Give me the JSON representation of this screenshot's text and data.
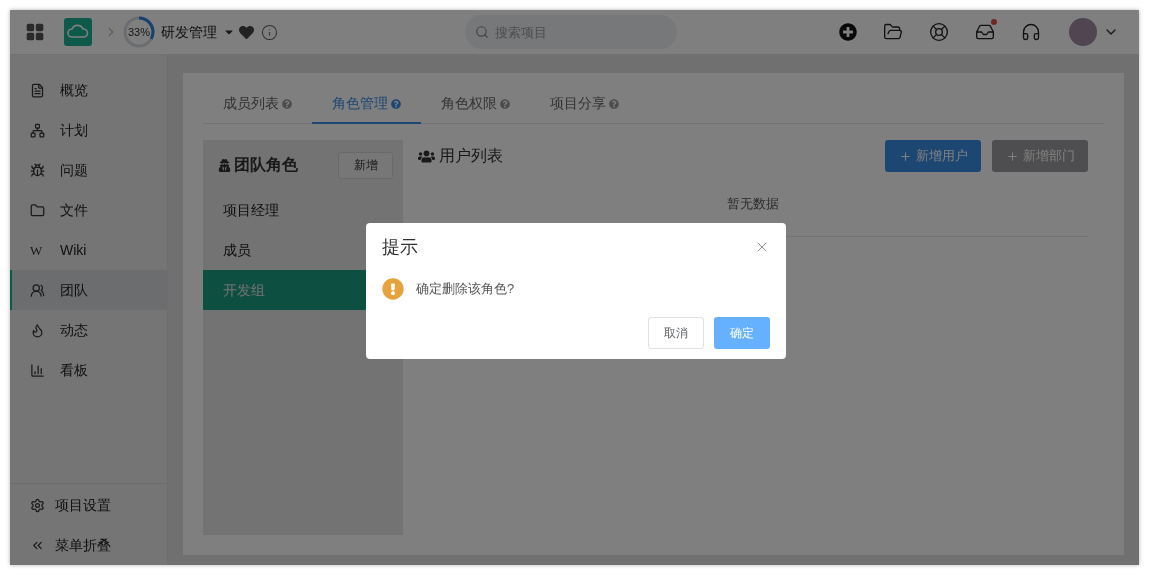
{
  "header": {
    "progress": {
      "label": "33%",
      "level": 0.33
    },
    "project_title": "研发管理",
    "search": {
      "placeholder": "搜索项目"
    },
    "toolbar": [
      {
        "kind": "add"
      },
      {
        "kind": "folder"
      },
      {
        "kind": "help"
      },
      {
        "kind": "inbox",
        "unread": true
      },
      {
        "kind": "support"
      }
    ]
  },
  "sidebar": {
    "items": [
      {
        "kind": "overview",
        "label": "概览",
        "selected": false
      },
      {
        "kind": "plan",
        "label": "计划",
        "selected": false
      },
      {
        "kind": "issue",
        "label": "问题",
        "selected": false
      },
      {
        "kind": "file",
        "label": "文件",
        "selected": false
      },
      {
        "kind": "wiki",
        "glyph": "W",
        "label": "Wiki",
        "selected": false
      },
      {
        "kind": "team",
        "label": "团队",
        "selected": true
      },
      {
        "kind": "activity",
        "label": "动态",
        "selected": false
      },
      {
        "kind": "board",
        "label": "看板",
        "selected": false
      }
    ],
    "footer": [
      {
        "kind": "settings",
        "label": "项目设置"
      },
      {
        "kind": "collapse",
        "label": "菜单折叠"
      }
    ]
  },
  "tabs": [
    {
      "label": "成员列表",
      "selected": false
    },
    {
      "label": "角色管理",
      "selected": true
    },
    {
      "label": "角色权限",
      "selected": false
    },
    {
      "label": "项目分享",
      "selected": false
    }
  ],
  "roles": {
    "title": "团队角色",
    "add_button": "新增",
    "items": [
      {
        "label": "项目经理",
        "selected": false
      },
      {
        "label": "成员",
        "selected": false
      },
      {
        "label": "开发组",
        "selected": true
      }
    ]
  },
  "users": {
    "title": "用户列表",
    "buttons": [
      {
        "label": "新增用户",
        "kind": "primary"
      },
      {
        "label": "新增部门",
        "kind": "disabled"
      }
    ],
    "empty_text": "暂无数据"
  },
  "dialog": {
    "title": "提示",
    "message": "确定删除该角色?",
    "cancel": "取消",
    "confirm": "确定"
  }
}
